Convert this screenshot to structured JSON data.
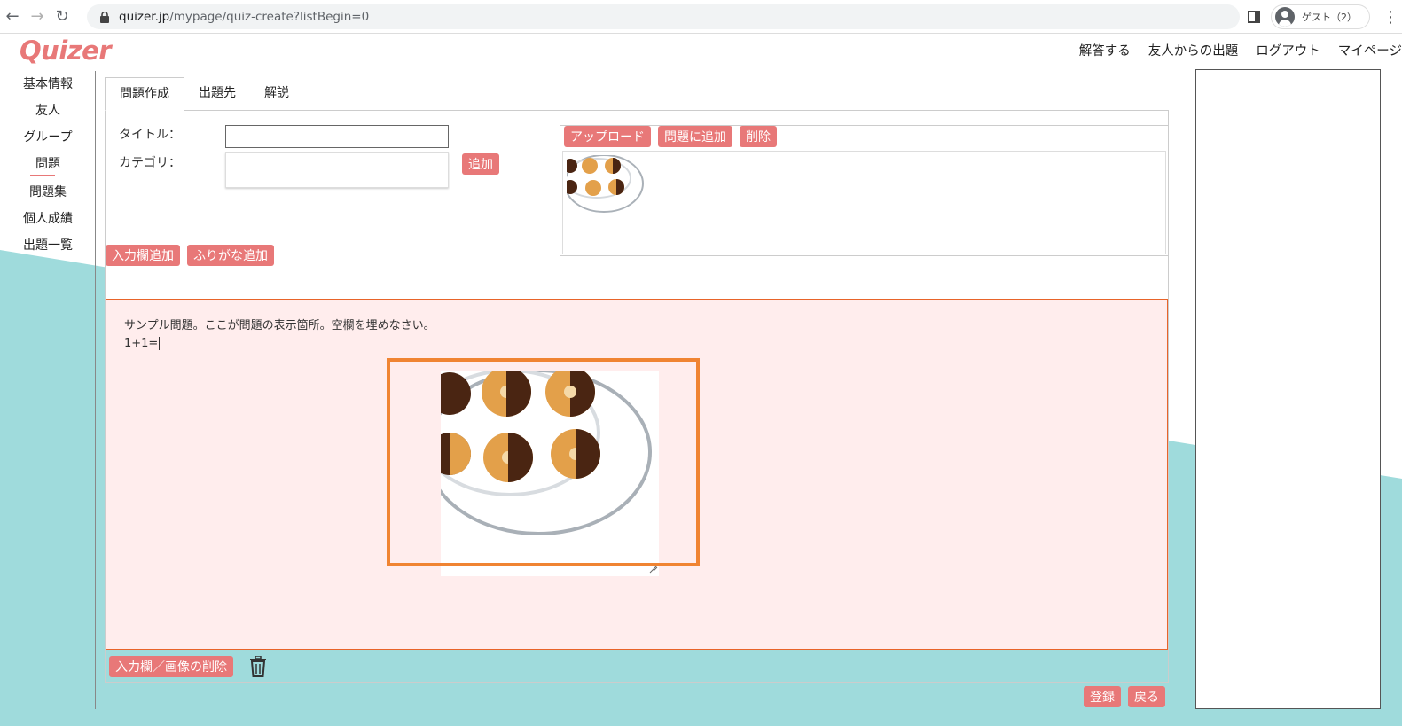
{
  "browser": {
    "url_host": "quizer.jp",
    "url_path": "/mypage/quiz-create?listBegin=0",
    "profile_label": "ゲスト（2）"
  },
  "site": {
    "logo": "Quizer",
    "top_nav": [
      "解答する",
      "友人からの出題",
      "ログアウト",
      "マイページ"
    ]
  },
  "sidebar": {
    "items": [
      {
        "label": "基本情報"
      },
      {
        "label": "友人"
      },
      {
        "label": "グループ"
      },
      {
        "label": "問題"
      },
      {
        "label": "問題集"
      },
      {
        "label": "個人成績"
      },
      {
        "label": "出題一覧"
      }
    ],
    "active_index": 3
  },
  "tabs": [
    "問題作成",
    "出題先",
    "解説"
  ],
  "form": {
    "title_label": "タイトル：",
    "title_value": "",
    "category_label": "カテゴリ：",
    "add_button": "追加"
  },
  "image_panel": {
    "upload_button": "アップロード",
    "add_to_question_button": "問題に追加",
    "delete_button": "削除"
  },
  "field_buttons": {
    "add_input": "入力欄追加",
    "add_furigana": "ふりがな追加"
  },
  "question": {
    "line1": "サンプル問題。ここが問題の表示箇所。空欄を埋めなさい。",
    "line2": "1+1="
  },
  "bottom": {
    "delete_field_image": "入力欄／画像の削除",
    "register": "登録",
    "back": "戻る"
  },
  "colors": {
    "accent": "#e87878",
    "teal_bg": "#9fdbdc",
    "question_bg": "#ffeded",
    "highlight": "#f08432"
  }
}
